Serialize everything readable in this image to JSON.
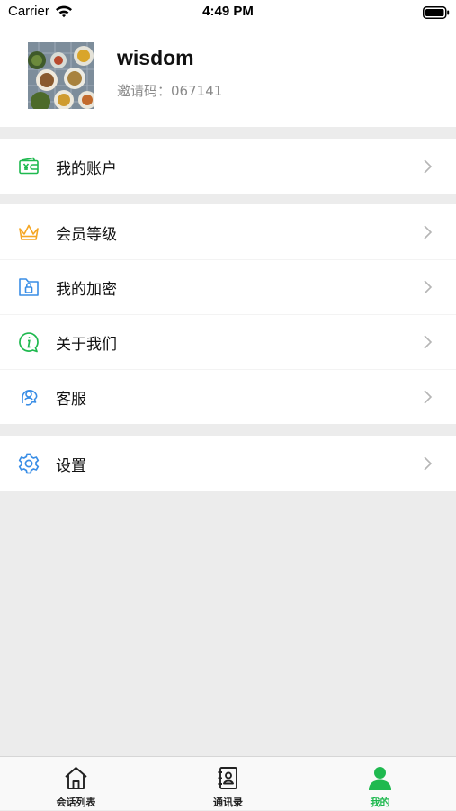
{
  "status_bar": {
    "carrier": "Carrier",
    "time": "4:49 PM"
  },
  "profile": {
    "username": "wisdom",
    "invite_label": "邀请码：",
    "invite_code": "067141"
  },
  "menu": {
    "account": {
      "label": "我的账户",
      "icon": "wallet-icon",
      "color": "#1fb94f"
    },
    "membership": {
      "label": "会员等级",
      "icon": "crown-icon",
      "color": "#f5a623"
    },
    "encryption": {
      "label": "我的加密",
      "icon": "lock-folder-icon",
      "color": "#3a8ee6"
    },
    "about": {
      "label": "关于我们",
      "icon": "info-icon",
      "color": "#1fb94f"
    },
    "support": {
      "label": "客服",
      "icon": "support-headset-icon",
      "color": "#3a8ee6"
    },
    "settings": {
      "label": "设置",
      "icon": "gear-icon",
      "color": "#3a8ee6"
    }
  },
  "tabbar": {
    "tabs": [
      {
        "label": "会话列表",
        "icon": "home-icon",
        "active": false
      },
      {
        "label": "通讯录",
        "icon": "contacts-book-icon",
        "active": false
      },
      {
        "label": "我的",
        "icon": "person-icon",
        "active": true
      }
    ],
    "active_color": "#1fb94f"
  }
}
